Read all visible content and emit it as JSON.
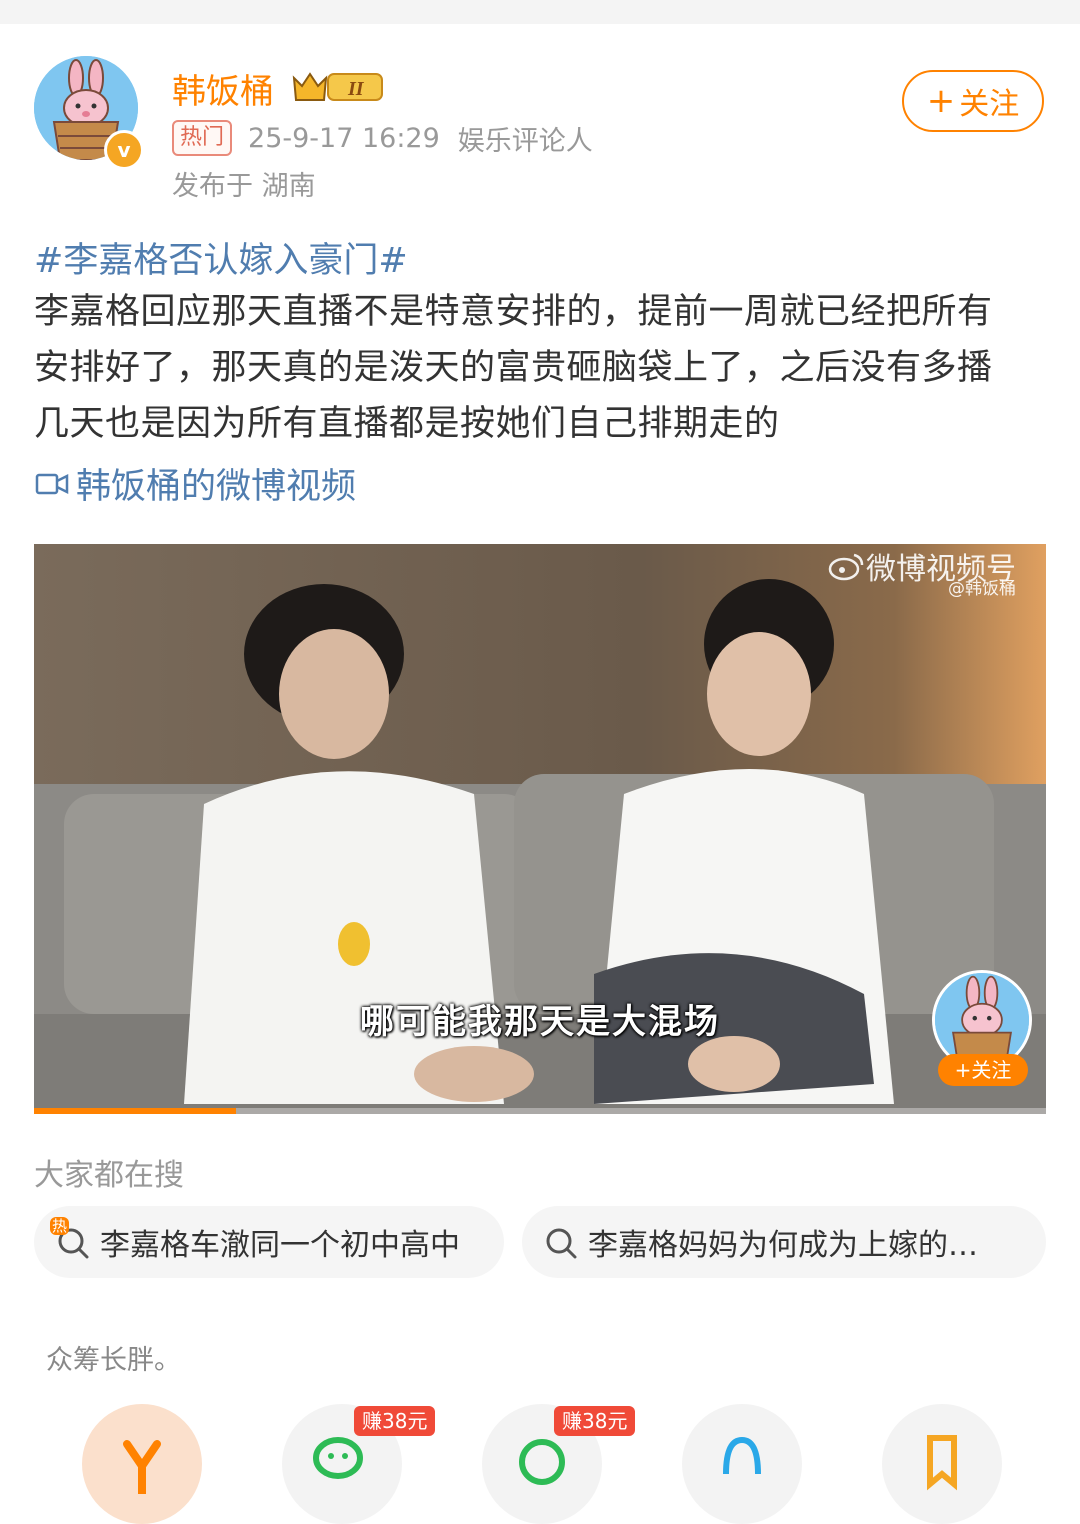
{
  "post": {
    "username": "韩饭桶",
    "vip_level": "II",
    "hot_tag": "热门",
    "time": "25-9-17 16:29",
    "source": "娱乐评论人",
    "location": "发布于 湖南",
    "follow_label": "关注",
    "hashtag": "#李嘉格否认嫁入豪门#",
    "text": "李嘉格回应那天直播不是特意安排的，提前一周就已经把所有安排好了，那天真的是泼天的富贵砸脑袋上了，之后没有多播几天也是因为所有直播都是按她们自己排期走的",
    "video_link": "韩饭桶的微博视频"
  },
  "video": {
    "watermark": "微博视频号",
    "watermark_user": "@韩饭桶",
    "subtitle": "哪可能我那天是大混场",
    "follow_label": "+关注",
    "progress": 0.2
  },
  "search": {
    "title": "大家都在搜",
    "hot_icon_label": "热",
    "items": [
      "李嘉格车澈同一个初中高中",
      "李嘉格妈妈为何成为上嫁的…"
    ]
  },
  "footer": {
    "crowd_text": "众筹长胖。",
    "earn_badges": [
      "赚38元",
      "赚38元"
    ]
  },
  "colors": {
    "accent": "#ff8200",
    "link": "#507daf"
  }
}
